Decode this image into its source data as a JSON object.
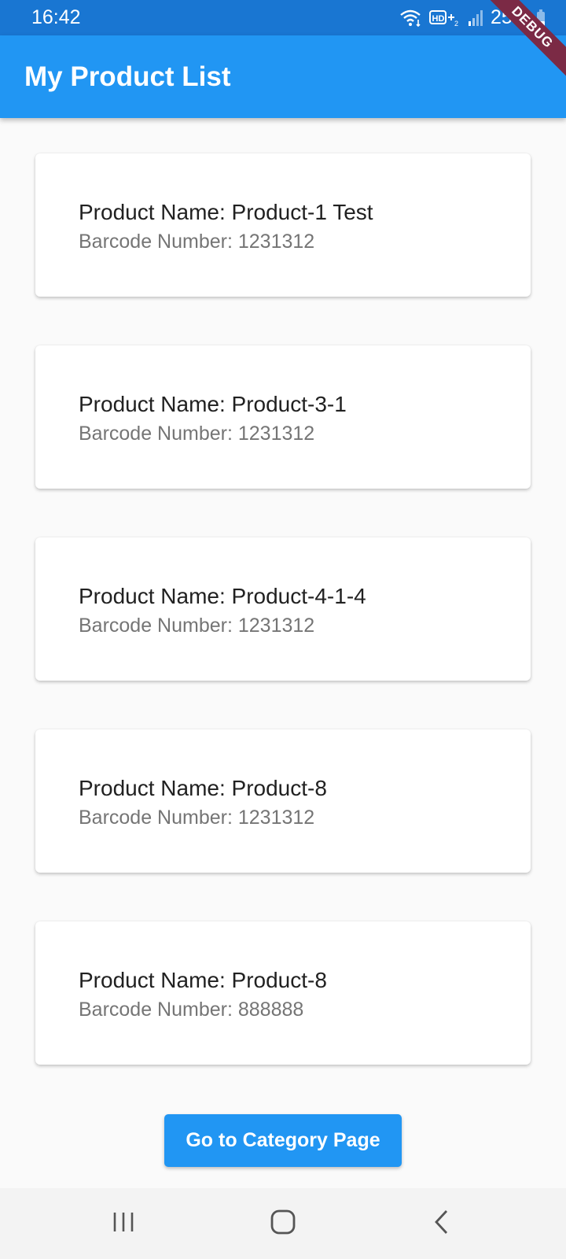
{
  "status_bar": {
    "time": "16:42",
    "battery": "25%",
    "icons": [
      "wifi-icon",
      "hd-icon",
      "signal-icon",
      "battery-icon"
    ]
  },
  "debug_banner": "DEBUG",
  "app_bar": {
    "title": "My Product List",
    "color": "#2196f3"
  },
  "products": [
    {
      "name": "Product Name: Product-1 Test",
      "barcode": "Barcode Number: 1231312"
    },
    {
      "name": "Product Name: Product-3-1",
      "barcode": "Barcode Number: 1231312"
    },
    {
      "name": "Product Name: Product-4-1-4",
      "barcode": "Barcode Number: 1231312"
    },
    {
      "name": "Product Name: Product-8",
      "barcode": "Barcode Number: 1231312"
    },
    {
      "name": "Product Name: Product-8",
      "barcode": "Barcode Number: 888888"
    }
  ],
  "category_button": {
    "label": "Go to Category Page"
  },
  "nav_bar": {
    "buttons": [
      "recents-icon",
      "home-icon",
      "back-icon"
    ]
  }
}
